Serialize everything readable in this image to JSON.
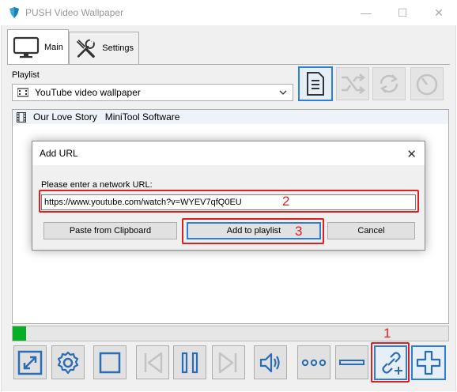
{
  "window": {
    "title": "PUSH Video Wallpaper",
    "controls": [
      "—",
      "☐",
      "✕"
    ]
  },
  "tabs": [
    {
      "label": "Main",
      "icon": "monitor-icon",
      "active": true
    },
    {
      "label": "Settings",
      "icon": "tools-icon",
      "active": false
    }
  ],
  "playlist": {
    "label": "Playlist",
    "selected": "YouTube video wallpaper",
    "items": [
      {
        "title": "Our Love Story   MiniTool Software"
      }
    ]
  },
  "playlist_tools": [
    {
      "icon": "playlist-document-icon",
      "selected": true
    },
    {
      "icon": "shuffle-icon",
      "selected": false
    },
    {
      "icon": "refresh-icon",
      "selected": false
    },
    {
      "icon": "timer-icon",
      "selected": false
    }
  ],
  "progress": {
    "fraction": 0.03,
    "color": "#06b025"
  },
  "bottom_toolbar": [
    {
      "icon": "fullscreen-icon"
    },
    {
      "icon": "settings-gear-icon"
    },
    {
      "icon": "stop-icon"
    },
    {
      "icon": "previous-icon"
    },
    {
      "icon": "pause-icon"
    },
    {
      "icon": "next-icon"
    },
    {
      "icon": "volume-icon"
    },
    {
      "icon": "more-icon"
    },
    {
      "icon": "remove-icon"
    },
    {
      "icon": "add-url-icon",
      "selected": true
    },
    {
      "icon": "add-icon",
      "selected": true
    }
  ],
  "dialog": {
    "title": "Add URL",
    "close": "✕",
    "prompt": "Please enter a network URL:",
    "url_value": "https://www.youtube.com/watch?v=WYEV7qfQ0EU",
    "buttons": {
      "paste": "Paste from Clipboard",
      "add": "Add to playlist",
      "cancel": "Cancel"
    }
  },
  "annotations": {
    "step1": "1",
    "step2": "2",
    "step3": "3",
    "color": "#e02020"
  },
  "colors": {
    "accent": "#2b7fd6",
    "icon_blue": "#2a6db5",
    "icon_disabled": "#c3c3c3"
  }
}
